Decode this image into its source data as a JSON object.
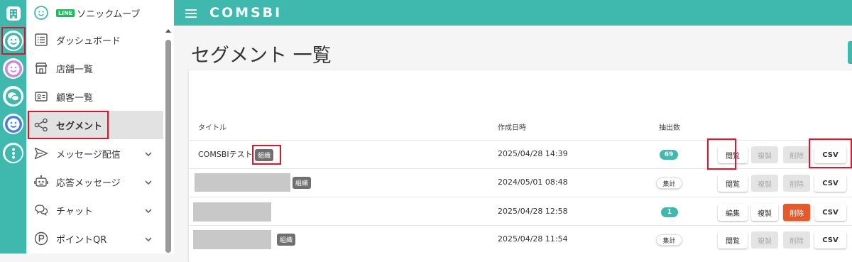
{
  "app": {
    "logo": "COMSBI"
  },
  "sidebar": {
    "account": {
      "badge": "LINE",
      "name": "ソニックムーブ"
    },
    "items": [
      {
        "label": "ダッシュボード",
        "icon": "dashboard-icon"
      },
      {
        "label": "店舗一覧",
        "icon": "store-icon"
      },
      {
        "label": "顧客一覧",
        "icon": "contact-card-icon"
      },
      {
        "label": "セグメント",
        "icon": "share-nodes-icon",
        "selected": true
      },
      {
        "label": "メッセージ配信",
        "icon": "send-icon",
        "expandable": true
      },
      {
        "label": "応答メッセージ",
        "icon": "robot-icon",
        "expandable": true
      },
      {
        "label": "チャット",
        "icon": "chat-icon",
        "expandable": true
      },
      {
        "label": "ポイントQR",
        "icon": "point-icon",
        "expandable": true
      }
    ]
  },
  "page": {
    "title": "セグメント 一覧"
  },
  "table": {
    "columns": [
      "タイトル",
      "作成日時",
      "抽出数"
    ],
    "rows": [
      {
        "title": "COMSBIテスト",
        "tag": "組織",
        "created": "2025/04/28 14:39",
        "count": "69",
        "count_style": "teal",
        "actions": [
          {
            "label": "閲覧",
            "state": "enabled"
          },
          {
            "label": "複製",
            "state": "disabled"
          },
          {
            "label": "削除",
            "state": "disabled"
          },
          {
            "label": "CSV",
            "state": "enabled"
          }
        ]
      },
      {
        "title": "",
        "tag": "組織",
        "created": "2024/05/01 08:48",
        "count": "集計",
        "count_style": "white",
        "actions": [
          {
            "label": "閲覧",
            "state": "enabled"
          },
          {
            "label": "複製",
            "state": "disabled"
          },
          {
            "label": "削除",
            "state": "disabled"
          },
          {
            "label": "CSV",
            "state": "enabled"
          }
        ]
      },
      {
        "title": "",
        "tag": "",
        "created": "2025/04/28 12:58",
        "count": "1",
        "count_style": "teal",
        "actions": [
          {
            "label": "編集",
            "state": "enabled"
          },
          {
            "label": "複製",
            "state": "enabled"
          },
          {
            "label": "削除",
            "state": "danger"
          },
          {
            "label": "CSV",
            "state": "enabled"
          }
        ]
      },
      {
        "title": "",
        "tag": "組織",
        "created": "2025/04/28 11:54",
        "count": "集計",
        "count_style": "white",
        "actions": [
          {
            "label": "閲覧",
            "state": "enabled"
          },
          {
            "label": "複製",
            "state": "disabled"
          },
          {
            "label": "削除",
            "state": "disabled"
          },
          {
            "label": "CSV",
            "state": "enabled"
          }
        ]
      }
    ]
  },
  "colors": {
    "teal": "#3fb8ae",
    "danger": "#e55a28",
    "highlight": "#e0142d"
  }
}
